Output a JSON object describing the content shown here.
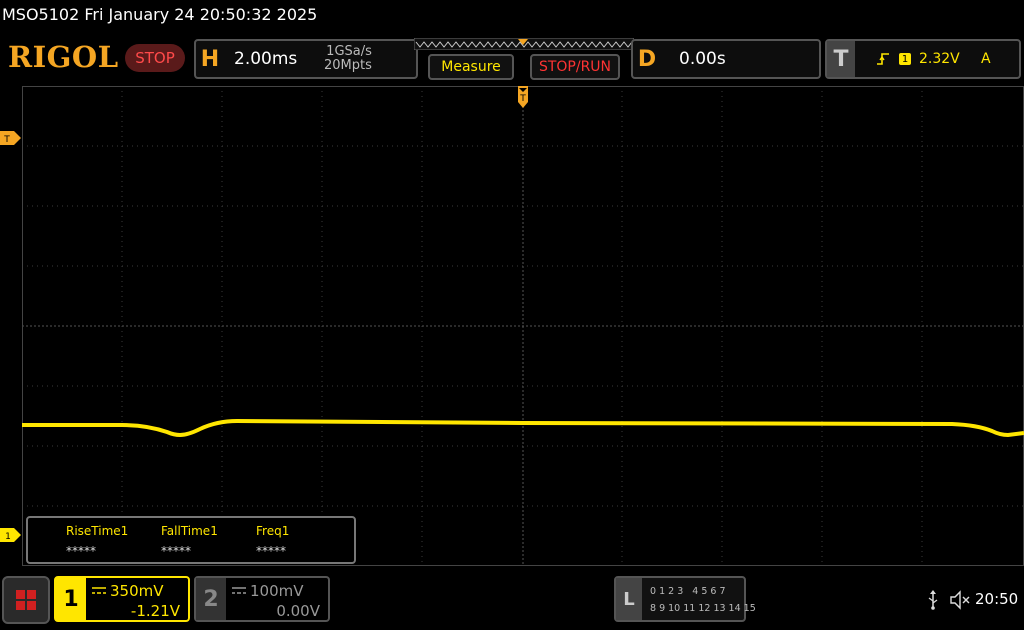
{
  "header": {
    "title": "MSO5102  Fri January 24 20:50:32 2025"
  },
  "brand": {
    "logo_text": "RIGOL",
    "run_state": "STOP"
  },
  "horizontal": {
    "key": "H",
    "timebase": "2.00ms",
    "sample_rate": "1GSa/s",
    "memory_depth": "20Mpts"
  },
  "buttons": {
    "measure": "Measure",
    "stop_run": "STOP/RUN"
  },
  "delay": {
    "key": "D",
    "value": "0.00s"
  },
  "trigger": {
    "key": "T",
    "source_badge": "1",
    "level": "2.32V",
    "mode": "A",
    "position_marker": "T",
    "level_marker": "T"
  },
  "measurements": [
    {
      "name": "RiseTime1",
      "value": "*****"
    },
    {
      "name": "FallTime1",
      "value": "*****"
    },
    {
      "name": "Freq1",
      "value": "*****"
    }
  ],
  "channels": {
    "ch1": {
      "number": "1",
      "scale": "350mV",
      "offset": "-1.21V",
      "marker": "1",
      "color": "#ffe600"
    },
    "ch2": {
      "number": "2",
      "scale": "100mV",
      "offset": "0.00V"
    }
  },
  "logic_analyzer": {
    "key": "L",
    "row1": "0 1 2 3   4 5 6 7",
    "row2": "8 9 10 11 12 13 14 15"
  },
  "status": {
    "clock": "20:50"
  },
  "colors": {
    "accent": "#f5a623",
    "ch1": "#ffe600",
    "stop": "#ff3333"
  }
}
